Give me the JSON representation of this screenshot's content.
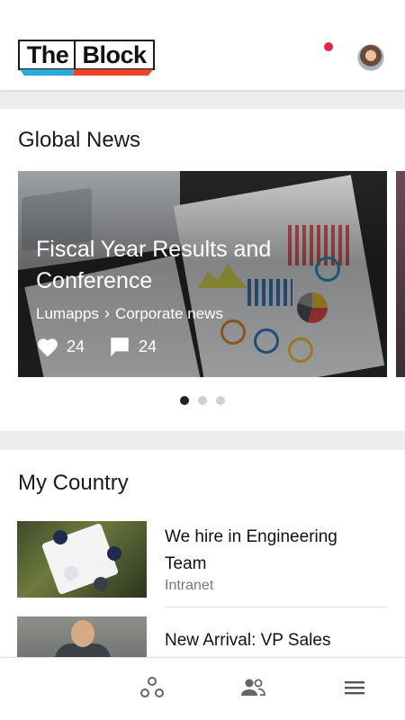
{
  "header": {
    "logo": {
      "part1": "The",
      "part2": "Block"
    },
    "notification_color": "#e3264a",
    "avatar": "user-avatar"
  },
  "global_news": {
    "title": "Global News",
    "card": {
      "title": "Fiscal Year Results and Conference",
      "source": "Lumapps",
      "separator_icon": "chevron-right-icon",
      "category": "Corporate news",
      "likes": "24",
      "comments": "24"
    },
    "pagination": {
      "pages": 3,
      "active": 1
    }
  },
  "my_country": {
    "title": "My Country",
    "items": [
      {
        "title": "We hire in Engineering Team",
        "subtitle": "Intranet",
        "thumbnail": "team-meeting-photo"
      },
      {
        "title": "New Arrival: VP Sales",
        "subtitle": "",
        "thumbnail": "smiling-man-photo"
      }
    ]
  },
  "bottom_nav": {
    "items": [
      {
        "icon": "communities-icon"
      },
      {
        "icon": "people-icon"
      },
      {
        "icon": "menu-icon"
      }
    ]
  },
  "colors": {
    "accent_cyan": "#29a9d9",
    "accent_red": "#e8452c",
    "background": "#ededed"
  }
}
